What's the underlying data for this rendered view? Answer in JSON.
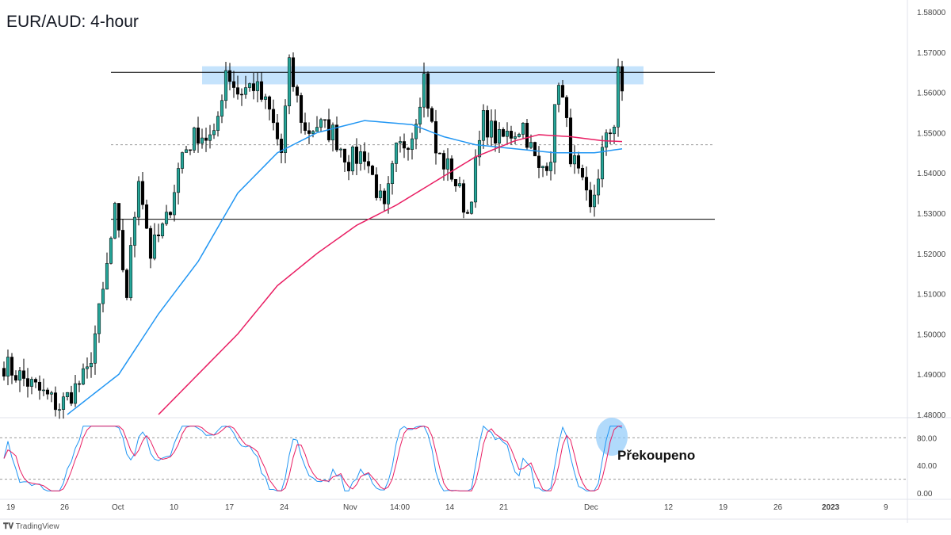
{
  "title": "EUR/AUD: 4-hour",
  "branding": "TradingView",
  "annotation": "Překoupeno",
  "chart_data": {
    "type": "candlestick",
    "symbol": "EUR/AUD",
    "timeframe": "4-hour",
    "y_ticks": [
      "1.58000",
      "1.57000",
      "1.56000",
      "1.55000",
      "1.54000",
      "1.53000",
      "1.52000",
      "1.51000",
      "1.50000",
      "1.49000",
      "1.48000"
    ],
    "ylim": [
      1.48,
      1.58
    ],
    "x_ticks": [
      "19",
      "26",
      "Oct",
      "10",
      "17",
      "24",
      "Nov",
      "14:00",
      "14",
      "21",
      "Dec",
      "12",
      "19",
      "26",
      "2023",
      "9"
    ],
    "price_path_by_candle_index": [
      [
        1,
        1.4925
      ],
      [
        15,
        1.482
      ],
      [
        22,
        1.49
      ],
      [
        26,
        1.51
      ],
      [
        29,
        1.53
      ],
      [
        32,
        1.51
      ],
      [
        35,
        1.54
      ],
      [
        38,
        1.52
      ],
      [
        42,
        1.528
      ],
      [
        46,
        1.545
      ],
      [
        50,
        1.55
      ],
      [
        54,
        1.548
      ],
      [
        57,
        1.566
      ],
      [
        60,
        1.56
      ],
      [
        64,
        1.562
      ],
      [
        68,
        1.555
      ],
      [
        71,
        1.545
      ],
      [
        73,
        1.566
      ],
      [
        77,
        1.55
      ],
      [
        80,
        1.552
      ],
      [
        84,
        1.55
      ],
      [
        88,
        1.543
      ],
      [
        92,
        1.545
      ],
      [
        97,
        1.53
      ],
      [
        100,
        1.545
      ],
      [
        104,
        1.55
      ],
      [
        107,
        1.564
      ],
      [
        110,
        1.545
      ],
      [
        114,
        1.54
      ],
      [
        118,
        1.53
      ],
      [
        122,
        1.553
      ],
      [
        126,
        1.548
      ],
      [
        132,
        1.552
      ],
      [
        136,
        1.54
      ],
      [
        139,
        1.545
      ],
      [
        141,
        1.564
      ],
      [
        144,
        1.545
      ],
      [
        149,
        1.53
      ],
      [
        152,
        1.545
      ],
      [
        155,
        1.553
      ],
      [
        156,
        1.567
      ],
      [
        157,
        1.558
      ]
    ],
    "ma_blue": [
      [
        17,
        1.48
      ],
      [
        30,
        1.49
      ],
      [
        40,
        1.505
      ],
      [
        50,
        1.518
      ],
      [
        60,
        1.535
      ],
      [
        70,
        1.545
      ],
      [
        80,
        1.55
      ],
      [
        92,
        1.553
      ],
      [
        104,
        1.552
      ],
      [
        112,
        1.549
      ],
      [
        120,
        1.547
      ],
      [
        130,
        1.546
      ],
      [
        140,
        1.545
      ],
      [
        150,
        1.545
      ],
      [
        157,
        1.546
      ]
    ],
    "ma_pink": [
      [
        40,
        1.48
      ],
      [
        50,
        1.49
      ],
      [
        60,
        1.5
      ],
      [
        70,
        1.512
      ],
      [
        80,
        1.52
      ],
      [
        90,
        1.527
      ],
      [
        100,
        1.532
      ],
      [
        110,
        1.538
      ],
      [
        120,
        1.544
      ],
      [
        130,
        1.548
      ],
      [
        136,
        1.5495
      ],
      [
        144,
        1.549
      ],
      [
        152,
        1.548
      ],
      [
        157,
        1.5478
      ]
    ],
    "levels": {
      "resistance": 1.565,
      "mid": 1.547,
      "support": 1.5285,
      "zone": [
        1.562,
        1.5665
      ]
    },
    "oscillator": {
      "y_ticks": [
        "80.00",
        "40.00",
        "0.00"
      ],
      "upper": 80,
      "lower": 20,
      "ylim": [
        0,
        100
      ]
    },
    "colors": {
      "up": "#26a69a",
      "down": "#000000",
      "ma_blue": "#2196f3",
      "ma_pink": "#e91e63",
      "zone": "#bbdefb"
    }
  }
}
